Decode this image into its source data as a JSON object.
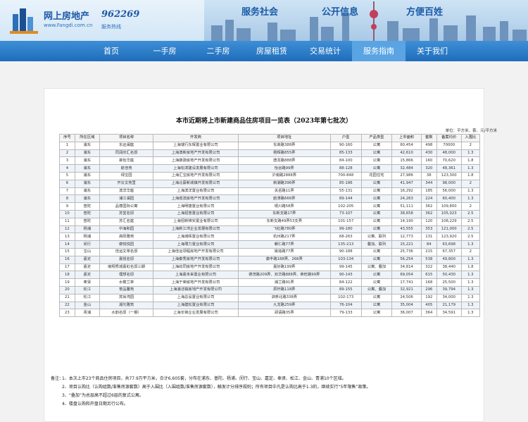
{
  "header": {
    "brand_name": "网上房地产",
    "brand_url": "www.Fangdi.com.cn",
    "hotline_number": "962269",
    "hotline_sub": "服务热线",
    "slogans": [
      "服务社会",
      "公开信息",
      "方便百姓"
    ],
    "colors": {
      "brand": "#1d58a6",
      "nav": "#2a7dc8",
      "nav_active": "#5aa4e4"
    }
  },
  "nav": {
    "items": [
      {
        "label": "首页"
      },
      {
        "label": "一手房"
      },
      {
        "label": "二手房"
      },
      {
        "label": "房屋租赁"
      },
      {
        "label": "交易统计"
      },
      {
        "label": "服务指南"
      },
      {
        "label": "关于我们"
      }
    ],
    "active": "服务指南"
  },
  "doc": {
    "title": "本市近期将上市新建商品住房项目一览表（2023年第七批次）",
    "unit_note": "单位：平方米、套、元/平方米",
    "columns": [
      "序号",
      "所在区域",
      "项目名称",
      "开发商",
      "项目地址",
      "户型",
      "产品类型",
      "上市面积",
      "套数",
      "备案均价",
      "入围比"
    ],
    "rows": [
      [
        "1",
        "浦东",
        "东远澜庭",
        "上海瑞行东辉置业有限公司",
        "东高路388弄",
        "90-160",
        "公寓",
        "60,454",
        "498",
        "70000",
        "2"
      ],
      [
        "2",
        "浦东",
        "同润欣汇名邸",
        "上海澳新房地产开发有限公司",
        "杨辉路855弄",
        "85-133",
        "公寓",
        "42,610",
        "430",
        "48,000",
        "1.3"
      ],
      [
        "3",
        "浦东",
        "荟怡华庭",
        "上海康骁房地产开发有限公司",
        "唐龙路888弄",
        "84-100",
        "公寓",
        "15,866",
        "160",
        "70,620",
        "1.8"
      ],
      [
        "4",
        "浦东",
        "航佳苑",
        "上海松滨建设发展有限公司",
        "怡谷路99弄",
        "88-128",
        "公寓",
        "32,484",
        "320",
        "48,361",
        "1.3"
      ],
      [
        "5",
        "浦东",
        "绿宝园",
        "上海汇宝房地产开发有限公司",
        "沪南路2888弄",
        "700-848",
        "花园住宅",
        "27,986",
        "38",
        "123,300",
        "1.8"
      ],
      [
        "6",
        "浦东",
        "开云文苑里",
        "上海北蔡新城镇开发有限公司",
        "新潮路396弄",
        "85-186",
        "公寓",
        "41,947",
        "344",
        "98,000",
        "2"
      ],
      [
        "7",
        "浦东",
        "滨洋华庭",
        "上海滨洋置业有限公司",
        "关岳路11弄",
        "55-131",
        "公寓",
        "16,292",
        "185",
        "56,000",
        "1.3"
      ],
      [
        "8",
        "浦东",
        "浦江澜园",
        "上海煜滨房地产开发有限公司",
        "韵涛路666弄",
        "89-144",
        "公寓",
        "24,263",
        "224",
        "60,400",
        "1.3"
      ],
      [
        "9",
        "普陀",
        "品尊国际公寓",
        "上海明捷置业有限公司",
        "铜川路58弄",
        "102-205",
        "公寓",
        "51,111",
        "362",
        "109,800",
        "2"
      ],
      [
        "10",
        "普陀",
        "苏堂名邸",
        "上海招普置业有限公司",
        "东新支路17弄",
        "73-107",
        "公寓",
        "38,658",
        "362",
        "105,023",
        "2.5"
      ],
      [
        "11",
        "普陀",
        "苏汇名庭",
        "上海招新锦实置业有限公司",
        "东新支路49弄53支弄",
        "101-157",
        "公寓",
        "14,190",
        "120",
        "108,229",
        "2.5"
      ],
      [
        "12",
        "杨浦",
        "中海和园",
        "上海新江湾企业发展有限公司",
        "飞虹路780弄",
        "99-180",
        "公寓",
        "43,555",
        "353",
        "121,000",
        "2.5"
      ],
      [
        "13",
        "杨浦",
        "高阳雅苑",
        "上海城晖置业有限公司",
        "杭州路217弄",
        "68-263",
        "公寓、联列",
        "12,773",
        "131",
        "123,920",
        "2.5"
      ],
      [
        "14",
        "闵行",
        "康悦悦园",
        "上海璞力置业有限公司",
        "朝仁路77弄",
        "135-213",
        "叠加、联列",
        "15,221",
        "84",
        "63,698",
        "1.3"
      ],
      [
        "15",
        "宝山",
        "佳运文萃名邸",
        "上海佳运领程房地产开发有限公司",
        "姚铭路77弄",
        "90-188",
        "公寓",
        "25,736",
        "215",
        "67,357",
        "2"
      ],
      [
        "16",
        "嘉定",
        "嘉悦名邸",
        "上海秦秀房地产开发有限公司",
        "康丰路188弄、266弄",
        "103-134",
        "公寓",
        "56,254",
        "538",
        "49,800",
        "1.3"
      ],
      [
        "17",
        "嘉定",
        "南翔秀城嘉虹名邸三期",
        "上海屿同房地产开发有限公司",
        "嘉好路199弄",
        "99-145",
        "公寓、叠加",
        "34,814",
        "322",
        "38,440",
        "1.8"
      ],
      [
        "18",
        "嘉定",
        "理想名邸",
        "上海嘉未来置业有限公司",
        "德茂路209弄、双华路888弄、荣旺路99弄",
        "90-143",
        "公寓",
        "69,054",
        "615",
        "50,430",
        "1.3"
      ],
      [
        "19",
        "奉贤",
        "水榭兰亭",
        "上海于荣房地产开发有限公司",
        "浦兰路91弄",
        "84-122",
        "公寓",
        "17,741",
        "168",
        "25,500",
        "1.3"
      ],
      [
        "20",
        "松江",
        "誉品馨苑",
        "上海浦洁镐房地产开发有限公司",
        "辰轩路118弄",
        "89-155",
        "公寓、叠加",
        "32,921",
        "296",
        "39,794",
        "1.3"
      ],
      [
        "21",
        "松江",
        "宾尚湾园",
        "上海总泓置业有限公司",
        "泗亭北路338弄",
        "102-173",
        "公寓",
        "24,506",
        "192",
        "34,000",
        "1.3"
      ],
      [
        "22",
        "金山",
        "湖光雅筑",
        "上海建松置业有限公司",
        "九龙路259弄",
        "76-104",
        "公寓",
        "35,004",
        "405",
        "21,179",
        "1.3"
      ],
      [
        "23",
        "青浦",
        "水韵名邸（一期）",
        "上海长锋企业发展有限公司",
        "郑语路35弄",
        "79-133",
        "公寓",
        "36,007",
        "364",
        "34,591",
        "1.3"
      ]
    ]
  },
  "notes": {
    "head": "备注：",
    "lines": [
      "1、本次上市23个商品住房项目，共77.9万平方米，合计6,605套，分布在浦东、普陀、杨浦、闵行、宝山、嘉定、奉贤、松江、金山、青浦10个区域。",
      "2、项目认购比（认购组数/准售房源套数）高于入围比（入围组数/准售房源套数），触发计分排序规则；所有项目中凡是认购比高于1.3的，继续实行“5年限售”政策。",
      "3、“叠加”为总层高不超过6层的复式公寓。",
      "4、楼盘认购和开盘日期另行公布。"
    ]
  }
}
